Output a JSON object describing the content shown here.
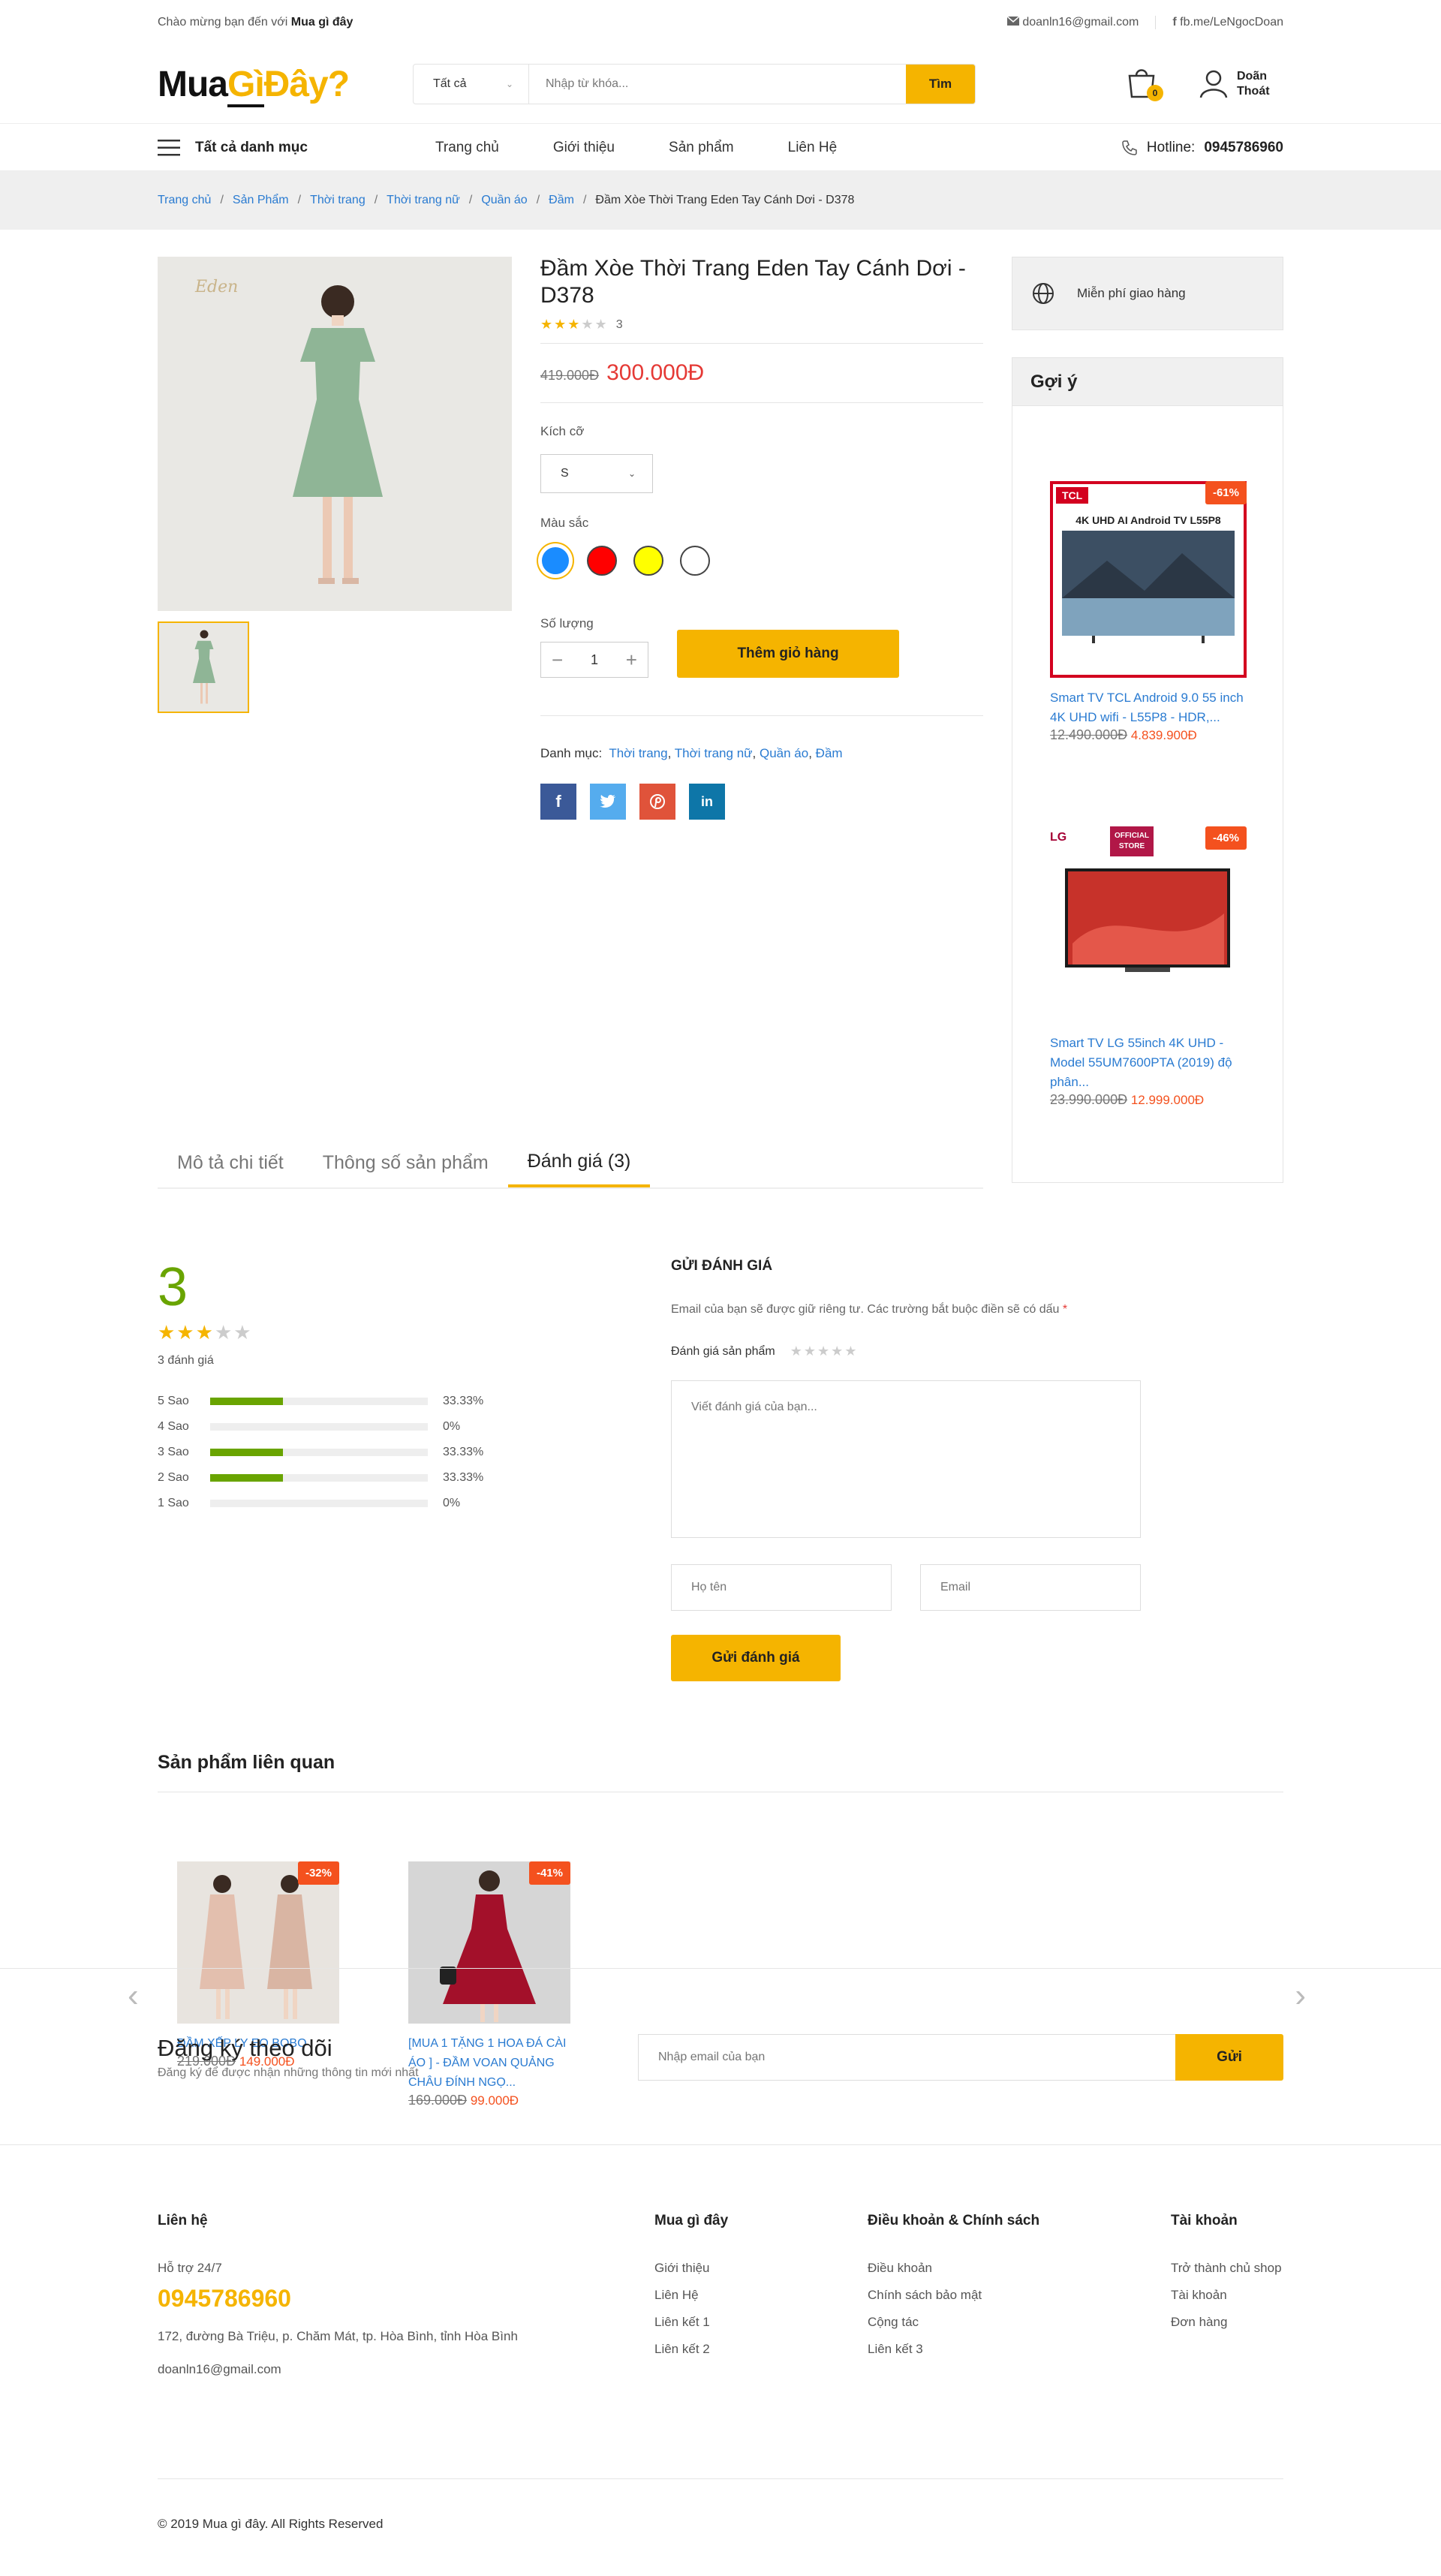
{
  "topbar": {
    "welcome": "Chào mừng bạn đến với",
    "site": "Mua gì đây",
    "email": "doanln16@gmail.com",
    "fb": "fb.me/LeNgocDoan"
  },
  "header": {
    "logo": {
      "a": "Mua",
      "b": "Gì",
      "c": "Đây?"
    },
    "category": "Tất cả",
    "search_placeholder": "Nhập từ khóa...",
    "search_button": "Tìm",
    "cart_count": "0",
    "user_name": "Doãn",
    "user_logout": "Thoát"
  },
  "nav": {
    "all_categories": "Tất cả danh mục",
    "links": [
      "Trang chủ",
      "Giới thiệu",
      "Sản phẩm",
      "Liên Hệ"
    ],
    "hotline_label": "Hotline:",
    "hotline": "0945786960"
  },
  "breadcrumb": [
    "Trang chủ",
    "Sản Phẩm",
    "Thời trang",
    "Thời trang nữ",
    "Quần áo",
    "Đầm",
    "Đầm Xòe Thời Trang Eden Tay Cánh Dơi - D378"
  ],
  "product": {
    "title": "Đầm Xòe Thời Trang Eden Tay Cánh Dơi - D378",
    "rating_count": "3",
    "stars": 3,
    "old_price": "419.000Đ",
    "price": "300.000Đ",
    "size_label": "Kích cỡ",
    "size": "S",
    "color_label": "Màu sắc",
    "colors": [
      "#1a8cff",
      "#ff0000",
      "#ffff00",
      "#ffffff"
    ],
    "qty_label": "Số lượng",
    "qty": "1",
    "add_to_cart": "Thêm giỏ hàng",
    "category_label": "Danh mục:",
    "categories": [
      "Thời trang",
      "Thời trang nữ",
      "Quần áo",
      "Đầm"
    ],
    "watermark": "Eden"
  },
  "sidebar": {
    "shipping": "Miễn phí giao hàng",
    "suggest_title": "Gợi ý",
    "items": [
      {
        "name": "Smart TV TCL Android 9.0 55 inch 4K UHD wifi - L55P8 - HDR,...",
        "old": "12.490.000Đ",
        "price": "4.839.900Đ",
        "discount": "-61%",
        "brand": "TCL",
        "banner": "4K UHD AI Android TV L55P8"
      },
      {
        "name": "Smart TV LG 55inch 4K UHD - Model 55UM7600PTA (2019) độ phân...",
        "old": "23.990.000Đ",
        "price": "12.999.000Đ",
        "discount": "-46%",
        "brand": "LG",
        "store": "OFFICIAL STORE"
      }
    ]
  },
  "tabs": [
    "Mô tả chi tiết",
    "Thông số sản phẩm",
    "Đánh giá (3)"
  ],
  "reviews": {
    "score": "3",
    "stars": 3,
    "count": "3 đánh giá",
    "bars": [
      {
        "label": "5 Sao",
        "pct": "33.33%",
        "v": 33.33
      },
      {
        "label": "4 Sao",
        "pct": "0%",
        "v": 0
      },
      {
        "label": "3 Sao",
        "pct": "33.33%",
        "v": 33.33
      },
      {
        "label": "2 Sao",
        "pct": "33.33%",
        "v": 33.33
      },
      {
        "label": "1 Sao",
        "pct": "0%",
        "v": 0
      }
    ],
    "form_title": "GỬI ĐÁNH GIÁ",
    "note": "Email của bạn sẽ được giữ riêng tư. Các trường bắt buộc điền sẽ có dấu",
    "rate_label": "Đánh giá sản phẩm",
    "textarea_placeholder": "Viết đánh giá của bạn...",
    "name_placeholder": "Họ tên",
    "email_placeholder": "Email",
    "submit": "Gửi đánh giá"
  },
  "related": {
    "title": "Sản phẩm liên quan",
    "items": [
      {
        "name": "ĐẦM XẾP LY EO BOBO",
        "old": "219.000Đ",
        "price": "149.000Đ",
        "discount": "-32%"
      },
      {
        "name": "[MUA 1 TẶNG 1 HOA ĐÁ CÀI ÁO ] - ĐẦM VOAN QUẢNG CHÂU ĐÍNH NGỌ...",
        "old": "169.000Đ",
        "price": "99.000Đ",
        "discount": "-41%"
      }
    ]
  },
  "subscribe": {
    "title": "Đăng ký theo dõi",
    "subtitle": "Đăng ký để được nhận những thông tin mới nhất",
    "placeholder": "Nhập email của bạn",
    "button": "Gửi"
  },
  "footer": {
    "contact_title": "Liên hệ",
    "support": "Hỗ trợ 24/7",
    "phone": "0945786960",
    "address": "172, đường Bà Triệu, p. Chăm Mát, tp. Hòa Bình, tỉnh Hòa Bình",
    "email": "doanln16@gmail.com",
    "col2_title": "Mua gì đây",
    "col2": [
      "Giới thiệu",
      "Liên Hệ",
      "Liên kết 1",
      "Liên kết 2"
    ],
    "col3_title": "Điều khoản & Chính sách",
    "col3": [
      "Điều khoản",
      "Chính sách bảo mật",
      "Cộng tác",
      "Liên kết 3"
    ],
    "col4_title": "Tài khoản",
    "col4": [
      "Trở thành chủ shop",
      "Tài khoản",
      "Đơn hàng"
    ],
    "copyright": "© 2019 Mua gì đây. All Rights Reserved"
  }
}
